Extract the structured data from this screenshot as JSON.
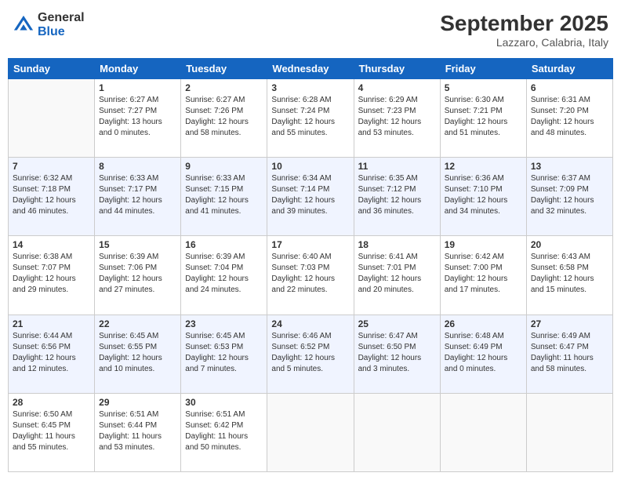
{
  "header": {
    "logo_general": "General",
    "logo_blue": "Blue",
    "month": "September 2025",
    "location": "Lazzaro, Calabria, Italy"
  },
  "days_of_week": [
    "Sunday",
    "Monday",
    "Tuesday",
    "Wednesday",
    "Thursday",
    "Friday",
    "Saturday"
  ],
  "weeks": [
    [
      {
        "day": "",
        "sunrise": "",
        "sunset": "",
        "daylight": ""
      },
      {
        "day": "1",
        "sunrise": "Sunrise: 6:27 AM",
        "sunset": "Sunset: 7:27 PM",
        "daylight": "Daylight: 13 hours and 0 minutes."
      },
      {
        "day": "2",
        "sunrise": "Sunrise: 6:27 AM",
        "sunset": "Sunset: 7:26 PM",
        "daylight": "Daylight: 12 hours and 58 minutes."
      },
      {
        "day": "3",
        "sunrise": "Sunrise: 6:28 AM",
        "sunset": "Sunset: 7:24 PM",
        "daylight": "Daylight: 12 hours and 55 minutes."
      },
      {
        "day": "4",
        "sunrise": "Sunrise: 6:29 AM",
        "sunset": "Sunset: 7:23 PM",
        "daylight": "Daylight: 12 hours and 53 minutes."
      },
      {
        "day": "5",
        "sunrise": "Sunrise: 6:30 AM",
        "sunset": "Sunset: 7:21 PM",
        "daylight": "Daylight: 12 hours and 51 minutes."
      },
      {
        "day": "6",
        "sunrise": "Sunrise: 6:31 AM",
        "sunset": "Sunset: 7:20 PM",
        "daylight": "Daylight: 12 hours and 48 minutes."
      }
    ],
    [
      {
        "day": "7",
        "sunrise": "Sunrise: 6:32 AM",
        "sunset": "Sunset: 7:18 PM",
        "daylight": "Daylight: 12 hours and 46 minutes."
      },
      {
        "day": "8",
        "sunrise": "Sunrise: 6:33 AM",
        "sunset": "Sunset: 7:17 PM",
        "daylight": "Daylight: 12 hours and 44 minutes."
      },
      {
        "day": "9",
        "sunrise": "Sunrise: 6:33 AM",
        "sunset": "Sunset: 7:15 PM",
        "daylight": "Daylight: 12 hours and 41 minutes."
      },
      {
        "day": "10",
        "sunrise": "Sunrise: 6:34 AM",
        "sunset": "Sunset: 7:14 PM",
        "daylight": "Daylight: 12 hours and 39 minutes."
      },
      {
        "day": "11",
        "sunrise": "Sunrise: 6:35 AM",
        "sunset": "Sunset: 7:12 PM",
        "daylight": "Daylight: 12 hours and 36 minutes."
      },
      {
        "day": "12",
        "sunrise": "Sunrise: 6:36 AM",
        "sunset": "Sunset: 7:10 PM",
        "daylight": "Daylight: 12 hours and 34 minutes."
      },
      {
        "day": "13",
        "sunrise": "Sunrise: 6:37 AM",
        "sunset": "Sunset: 7:09 PM",
        "daylight": "Daylight: 12 hours and 32 minutes."
      }
    ],
    [
      {
        "day": "14",
        "sunrise": "Sunrise: 6:38 AM",
        "sunset": "Sunset: 7:07 PM",
        "daylight": "Daylight: 12 hours and 29 minutes."
      },
      {
        "day": "15",
        "sunrise": "Sunrise: 6:39 AM",
        "sunset": "Sunset: 7:06 PM",
        "daylight": "Daylight: 12 hours and 27 minutes."
      },
      {
        "day": "16",
        "sunrise": "Sunrise: 6:39 AM",
        "sunset": "Sunset: 7:04 PM",
        "daylight": "Daylight: 12 hours and 24 minutes."
      },
      {
        "day": "17",
        "sunrise": "Sunrise: 6:40 AM",
        "sunset": "Sunset: 7:03 PM",
        "daylight": "Daylight: 12 hours and 22 minutes."
      },
      {
        "day": "18",
        "sunrise": "Sunrise: 6:41 AM",
        "sunset": "Sunset: 7:01 PM",
        "daylight": "Daylight: 12 hours and 20 minutes."
      },
      {
        "day": "19",
        "sunrise": "Sunrise: 6:42 AM",
        "sunset": "Sunset: 7:00 PM",
        "daylight": "Daylight: 12 hours and 17 minutes."
      },
      {
        "day": "20",
        "sunrise": "Sunrise: 6:43 AM",
        "sunset": "Sunset: 6:58 PM",
        "daylight": "Daylight: 12 hours and 15 minutes."
      }
    ],
    [
      {
        "day": "21",
        "sunrise": "Sunrise: 6:44 AM",
        "sunset": "Sunset: 6:56 PM",
        "daylight": "Daylight: 12 hours and 12 minutes."
      },
      {
        "day": "22",
        "sunrise": "Sunrise: 6:45 AM",
        "sunset": "Sunset: 6:55 PM",
        "daylight": "Daylight: 12 hours and 10 minutes."
      },
      {
        "day": "23",
        "sunrise": "Sunrise: 6:45 AM",
        "sunset": "Sunset: 6:53 PM",
        "daylight": "Daylight: 12 hours and 7 minutes."
      },
      {
        "day": "24",
        "sunrise": "Sunrise: 6:46 AM",
        "sunset": "Sunset: 6:52 PM",
        "daylight": "Daylight: 12 hours and 5 minutes."
      },
      {
        "day": "25",
        "sunrise": "Sunrise: 6:47 AM",
        "sunset": "Sunset: 6:50 PM",
        "daylight": "Daylight: 12 hours and 3 minutes."
      },
      {
        "day": "26",
        "sunrise": "Sunrise: 6:48 AM",
        "sunset": "Sunset: 6:49 PM",
        "daylight": "Daylight: 12 hours and 0 minutes."
      },
      {
        "day": "27",
        "sunrise": "Sunrise: 6:49 AM",
        "sunset": "Sunset: 6:47 PM",
        "daylight": "Daylight: 11 hours and 58 minutes."
      }
    ],
    [
      {
        "day": "28",
        "sunrise": "Sunrise: 6:50 AM",
        "sunset": "Sunset: 6:45 PM",
        "daylight": "Daylight: 11 hours and 55 minutes."
      },
      {
        "day": "29",
        "sunrise": "Sunrise: 6:51 AM",
        "sunset": "Sunset: 6:44 PM",
        "daylight": "Daylight: 11 hours and 53 minutes."
      },
      {
        "day": "30",
        "sunrise": "Sunrise: 6:51 AM",
        "sunset": "Sunset: 6:42 PM",
        "daylight": "Daylight: 11 hours and 50 minutes."
      },
      {
        "day": "",
        "sunrise": "",
        "sunset": "",
        "daylight": ""
      },
      {
        "day": "",
        "sunrise": "",
        "sunset": "",
        "daylight": ""
      },
      {
        "day": "",
        "sunrise": "",
        "sunset": "",
        "daylight": ""
      },
      {
        "day": "",
        "sunrise": "",
        "sunset": "",
        "daylight": ""
      }
    ]
  ]
}
